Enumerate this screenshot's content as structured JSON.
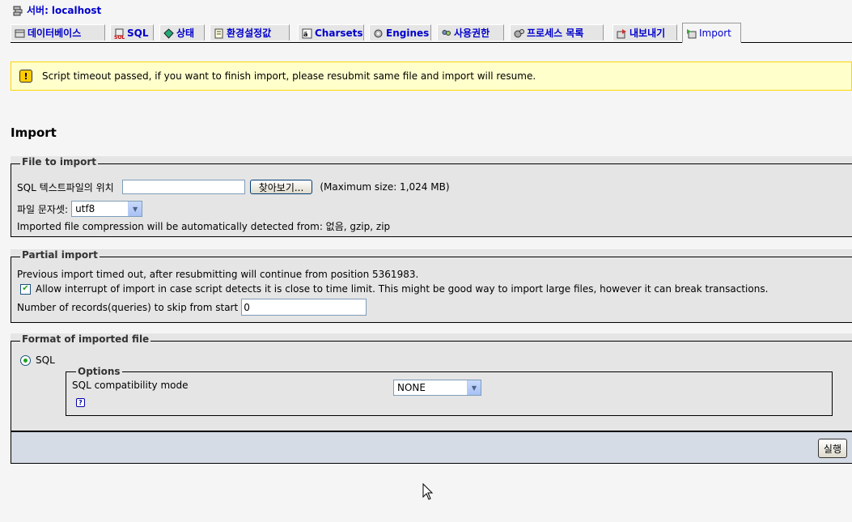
{
  "server": {
    "label": "서버:",
    "host": "localhost"
  },
  "tabs": [
    {
      "label": "데이터베이스",
      "icon": "database-icon"
    },
    {
      "label": "SQL",
      "icon": "sql-icon"
    },
    {
      "label": "상태",
      "icon": "status-icon"
    },
    {
      "label": "환경설정값",
      "icon": "variables-icon"
    },
    {
      "label": "Charsets",
      "icon": "charsets-icon"
    },
    {
      "label": "Engines",
      "icon": "engines-icon"
    },
    {
      "label": "사용권한",
      "icon": "privileges-icon"
    },
    {
      "label": "프로세스 목록",
      "icon": "processes-icon"
    },
    {
      "label": "내보내기",
      "icon": "export-icon"
    },
    {
      "label": "Import",
      "icon": "import-icon"
    }
  ],
  "notice": {
    "text": "Script timeout passed, if you want to finish import, please resubmit same file and import will resume."
  },
  "page_title": "Import",
  "file_section": {
    "legend": "File to import",
    "location_label": "SQL 텍스트파일의 위치",
    "file_value": "",
    "browse_label": "찾아보기...",
    "max_size": "(Maximum size: 1,024 MB)",
    "charset_label": "파일 문자셋:",
    "charset_value": "utf8",
    "compression_text": "Imported file compression will be automatically detected from: 없음, gzip, zip"
  },
  "partial_section": {
    "legend": "Partial import",
    "timeout_text": "Previous import timed out, after resubmitting will continue from position 5361983.",
    "allow_interrupt_checked": true,
    "allow_interrupt_label": "Allow interrupt of import in case script detects it is close to time limit. This might be good way to import large files, however it can break transactions.",
    "skip_label": "Number of records(queries) to skip from start",
    "skip_value": "0"
  },
  "format_section": {
    "legend": "Format of imported file",
    "format_option": "SQL",
    "options_legend": "Options",
    "compat_label": "SQL compatibility mode",
    "compat_value": "NONE"
  },
  "submit_label": "실행"
}
